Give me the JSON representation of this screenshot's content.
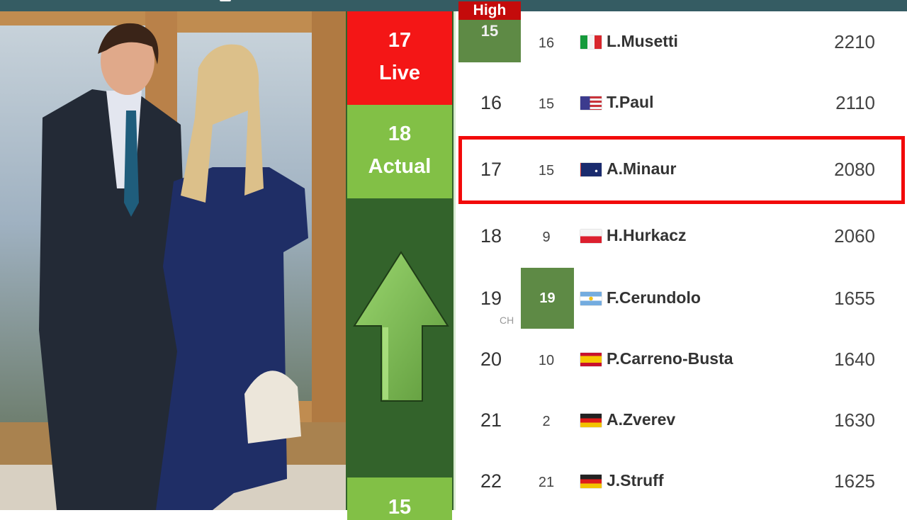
{
  "header": {
    "color": "#355c63"
  },
  "photo": {
    "description": "Couple posing in formal attire in front of wooden-framed windows",
    "subjects": [
      "man-in-dark-suit",
      "woman-in-navy-dress"
    ]
  },
  "status": {
    "live": {
      "rank": "17",
      "label": "Live",
      "color": "#f41616"
    },
    "actual": {
      "rank": "18",
      "label": "Actual",
      "color": "#82c046"
    },
    "trend": "up",
    "bottom": {
      "value": "15"
    },
    "colors": {
      "panel": "#33632b",
      "arrow": "#7fbf55"
    }
  },
  "table": {
    "highlight_color": "#f20a0a",
    "high_badge": {
      "label": "High",
      "value": "15"
    },
    "rows": [
      {
        "rank": "",
        "prev": "16",
        "flag": "italy",
        "name": "L.Musetti",
        "points": "2210"
      },
      {
        "rank": "16",
        "prev": "15",
        "flag": "usa",
        "name": "T.Paul",
        "points": "2110"
      },
      {
        "rank": "17",
        "prev": "15",
        "flag": "australia",
        "name": "A.Minaur",
        "points": "2080",
        "highlighted": true
      },
      {
        "rank": "18",
        "prev": "9",
        "flag": "poland",
        "name": "H.Hurkacz",
        "points": "2060"
      },
      {
        "rank": "19",
        "prev": "19",
        "flag": "argentina",
        "name": "F.Cerundolo",
        "points": "1655",
        "note": "CH",
        "prev_highlighted": true
      },
      {
        "rank": "20",
        "prev": "10",
        "flag": "spain",
        "name": "P.Carreno-Busta",
        "points": "1640"
      },
      {
        "rank": "21",
        "prev": "2",
        "flag": "germany",
        "name": "A.Zverev",
        "points": "1630"
      },
      {
        "rank": "22",
        "prev": "21",
        "flag": "germany",
        "name": "J.Struff",
        "points": "1625"
      }
    ]
  }
}
